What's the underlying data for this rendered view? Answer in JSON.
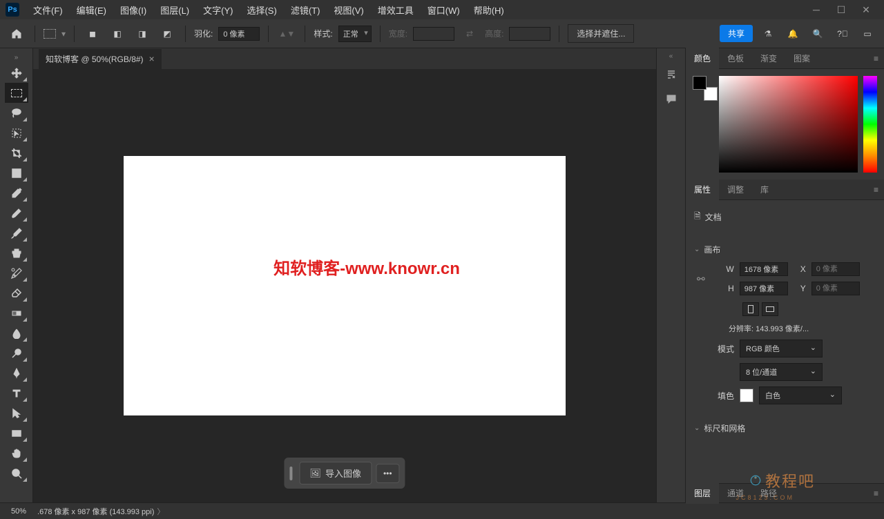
{
  "menu": {
    "file": "文件(F)",
    "edit": "编辑(E)",
    "image": "图像(I)",
    "layer": "图层(L)",
    "type": "文字(Y)",
    "select": "选择(S)",
    "filter": "滤镜(T)",
    "view": "视图(V)",
    "plugins": "增效工具",
    "window": "窗口(W)",
    "help": "帮助(H)"
  },
  "optbar": {
    "feather_label": "羽化:",
    "feather_value": "0 像素",
    "style_label": "样式:",
    "style_value": "正常",
    "width_label": "宽度:",
    "height_label": "高度:",
    "select_subject": "选择并遮住...",
    "share": "共享"
  },
  "document": {
    "tab_title": "知软博客 @ 50%(RGB/8#)",
    "watermark": "知软博客-www.knowr.cn"
  },
  "import_bar": {
    "import_image": "导入图像"
  },
  "panels": {
    "color_tabs": {
      "color": "颜色",
      "swatches": "色板",
      "gradients": "渐变",
      "patterns": "图案"
    },
    "props_tabs": {
      "properties": "属性",
      "adjustments": "调整",
      "libraries": "库"
    },
    "doc_label": "文档",
    "canvas_header": "画布",
    "w_label": "W",
    "w_value": "1678 像素",
    "h_label": "H",
    "h_value": "987 像素",
    "x_label": "X",
    "x_placeholder": "0 像素",
    "y_label": "Y",
    "y_placeholder": "0 像素",
    "resolution": "分辨率: 143.993 像素/...",
    "mode_label": "模式",
    "mode_value": "RGB 颜色",
    "depth_value": "8 位/通道",
    "fill_label": "填色",
    "fill_value": "白色",
    "rulers_header": "标尺和网格",
    "bottom_tabs": {
      "layers": "图层",
      "channels": "通道",
      "paths": "路径"
    }
  },
  "status": {
    "zoom": "50%",
    "info": ".678 像素 x 987 像素 (143.993 ppi)"
  },
  "overlay": {
    "brand": "教程吧",
    "url": "JC8123.COM"
  }
}
